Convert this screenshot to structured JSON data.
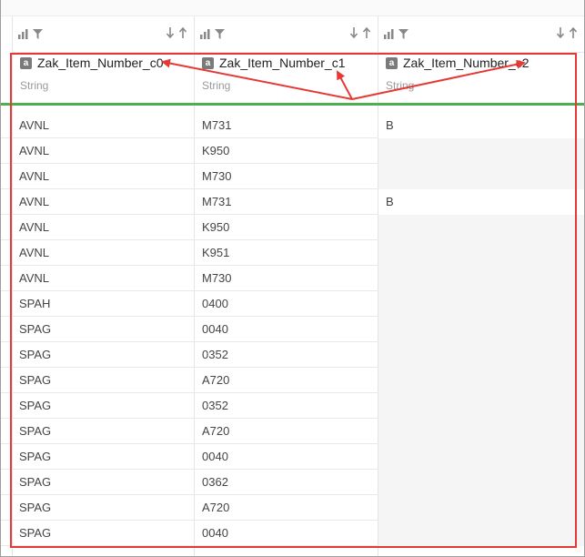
{
  "columns": [
    {
      "name": "Zak_Item_Number_c0",
      "type": "String",
      "badge": "a"
    },
    {
      "name": "Zak_Item_Number_c1",
      "type": "String",
      "badge": "a"
    },
    {
      "name": "Zak_Item_Number_c2",
      "type": "String",
      "badge": "a"
    }
  ],
  "toolbar": {
    "chart_icon": "bar-chart-icon",
    "filter_icon": "filter-icon",
    "sort_desc_icon": "sort-down-icon",
    "sort_asc_icon": "sort-up-icon"
  },
  "rows": [
    [
      "AVNL",
      "M731",
      "B"
    ],
    [
      "AVNL",
      "K950",
      ""
    ],
    [
      "AVNL",
      "M730",
      ""
    ],
    [
      "AVNL",
      "M731",
      "B"
    ],
    [
      "AVNL",
      "K950",
      ""
    ],
    [
      "AVNL",
      "K951",
      ""
    ],
    [
      "AVNL",
      "M730",
      ""
    ],
    [
      "SPAH",
      "0400",
      ""
    ],
    [
      "SPAG",
      "0040",
      ""
    ],
    [
      "SPAG",
      "0352",
      ""
    ],
    [
      "SPAG",
      "A720",
      ""
    ],
    [
      "SPAG",
      "0352",
      ""
    ],
    [
      "SPAG",
      "A720",
      ""
    ],
    [
      "SPAG",
      "0040",
      ""
    ],
    [
      "SPAG",
      "0362",
      ""
    ],
    [
      "SPAG",
      "A720",
      ""
    ],
    [
      "SPAG",
      "0040",
      ""
    ]
  ],
  "colors": {
    "highlight": "#e53935",
    "divider": "#4caf50",
    "empty_cell": "#f5f5f5"
  }
}
